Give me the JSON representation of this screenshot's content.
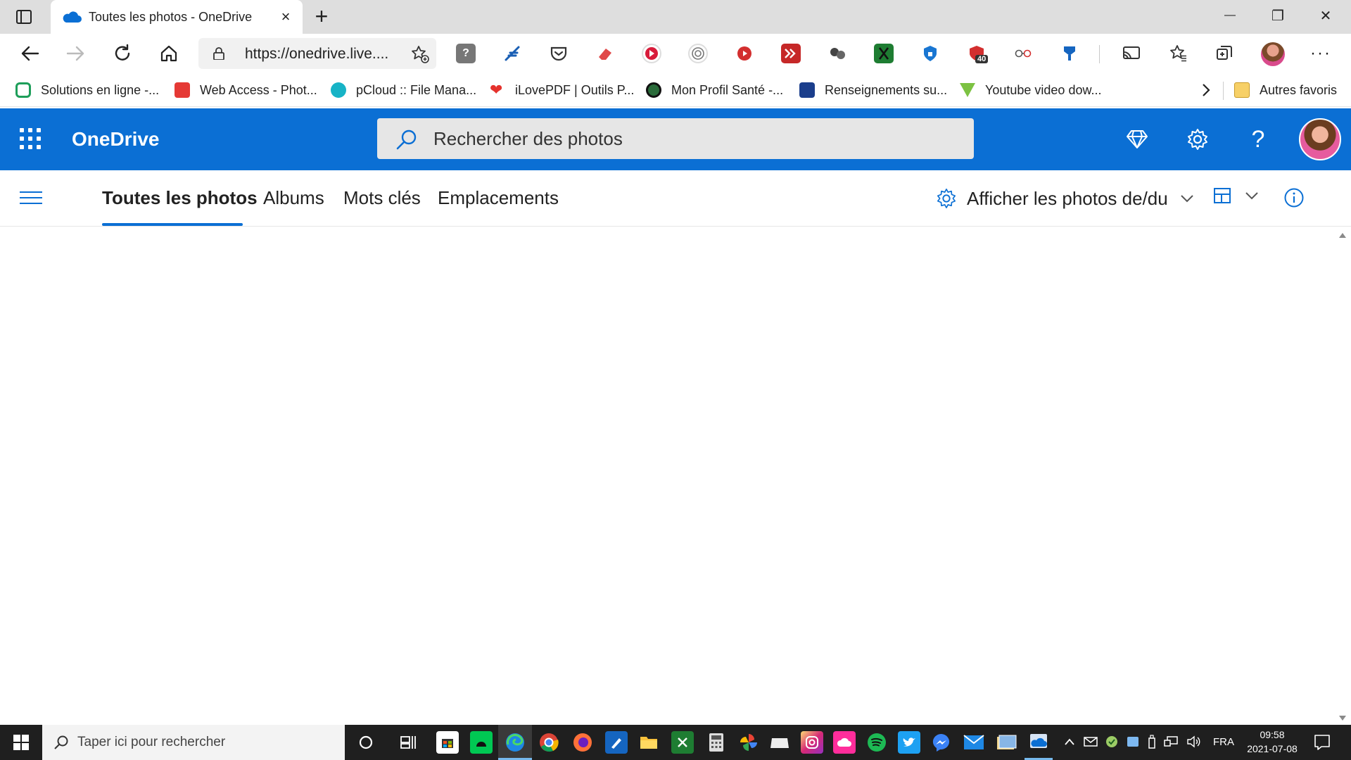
{
  "browser": {
    "tab_title": "Toutes les photos - OneDrive",
    "tab_close": "×",
    "new_tab": "+",
    "window_minimize": "—",
    "window_restore": "❐",
    "window_close": "✕",
    "url": "https://onedrive.live....",
    "more_menu": "···",
    "extension_badge": "40"
  },
  "bookmarks": [
    {
      "label": "Solutions en ligne -...",
      "color": "#1e9e5a"
    },
    {
      "label": "Web Access - Phot...",
      "color": "#e53935"
    },
    {
      "label": "pCloud :: File Mana...",
      "color": "#17b3c6"
    },
    {
      "label": "iLovePDF | Outils P...",
      "color": "#e5322d"
    },
    {
      "label": "Mon Profil Santé -...",
      "color": "#2a6b3a"
    },
    {
      "label": "Renseignements su...",
      "color": "#1b3e8c"
    },
    {
      "label": "Youtube video dow...",
      "color": "#7cc242"
    }
  ],
  "bookmarks_other": "Autres favoris",
  "onedrive": {
    "brand": "OneDrive",
    "search_placeholder": "Rechercher des photos"
  },
  "pivots": [
    {
      "label": "Toutes les photos",
      "active": true
    },
    {
      "label": "Albums",
      "active": false
    },
    {
      "label": "Mots clés",
      "active": false
    },
    {
      "label": "Emplacements",
      "active": false
    }
  ],
  "filter_label": "Afficher les photos de/du",
  "taskbar": {
    "search_placeholder": "Taper ici pour rechercher",
    "language": "FRA",
    "time": "09:58",
    "date": "2021-07-08"
  },
  "colors": {
    "onedrive_blue": "#0b6fd4",
    "tab_strip": "#dedede",
    "taskbar": "#1f1f1f"
  }
}
